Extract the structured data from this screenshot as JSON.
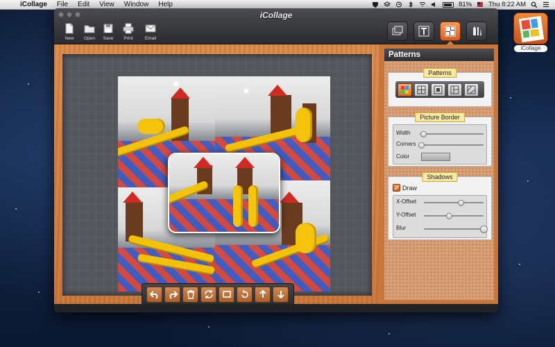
{
  "menubar": {
    "apple_glyph": "",
    "app_name": "iCollage",
    "menus": [
      "File",
      "Edit",
      "View",
      "Window",
      "Help"
    ],
    "battery": "81%",
    "clock": "Thu 8:22 AM"
  },
  "dock": {
    "label": "iCollage"
  },
  "window": {
    "title": "iCollage"
  },
  "toolbar": {
    "new_label": "New",
    "open_label": "Open",
    "save_label": "Save",
    "print_label": "Print",
    "email_label": "Email"
  },
  "mode_buttons": {
    "active": "patterns-mode-icon",
    "items": [
      "photos-mode-icon",
      "text-mode-icon",
      "patterns-mode-icon",
      "tools-mode-icon"
    ]
  },
  "inspector": {
    "title": "Patterns",
    "patterns_section": "Patterns",
    "pattern_items": [
      "pattern-colorful-icon",
      "pattern-grid-icon",
      "pattern-frame-icon",
      "pattern-split-icon",
      "pattern-scatter-icon"
    ],
    "border_section": "Picture Border",
    "width_label": "Width",
    "width_value": 0.05,
    "corners_label": "Corners",
    "corners_value": 0.02,
    "color_label": "Color",
    "shadows_section": "Shadows",
    "draw_label": "Draw",
    "draw_checked": true,
    "draw_check_glyph": "✓",
    "x_offset_label": "X-Offset",
    "x_offset_value": 0.62,
    "y_offset_label": "Y-Offset",
    "y_offset_value": 0.42,
    "blur_label": "Blur",
    "blur_value": 1.0
  },
  "bottombar": {
    "items": [
      "undo-icon",
      "redo-icon",
      "trash-icon",
      "shuffle-icon",
      "fit-icon",
      "rotate-icon",
      "bring-forward-icon",
      "send-backward-icon"
    ]
  },
  "colors": {
    "accent": "#e36a22",
    "wood": "#c8763a",
    "board": "#53565b"
  }
}
